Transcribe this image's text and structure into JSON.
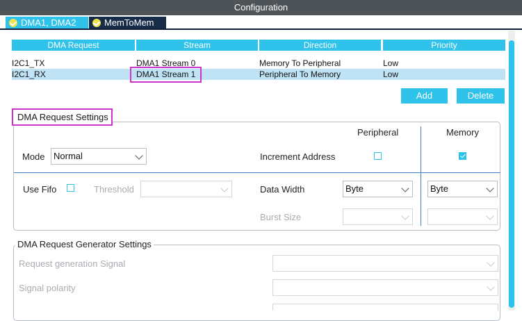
{
  "window": {
    "title": "Configuration"
  },
  "tabs": [
    {
      "label": "DMA1, DMA2",
      "icon": "check-circle-icon"
    },
    {
      "label": "MemToMem",
      "icon": "check-circle-icon"
    }
  ],
  "table": {
    "columns": [
      "DMA Request",
      "Stream",
      "Direction",
      "Priority"
    ],
    "rows": [
      {
        "request": "I2C1_TX",
        "stream": "DMA1 Stream 0",
        "direction": "Memory To Peripheral",
        "priority": "Low",
        "selected": false
      },
      {
        "request": "I2C1_RX",
        "stream": "DMA1 Stream 1",
        "direction": "Peripheral To Memory",
        "priority": "Low",
        "selected": true
      }
    ]
  },
  "buttons": {
    "add": "Add",
    "delete": "Delete"
  },
  "request_settings": {
    "title": "DMA Request Settings",
    "peripheral_header": "Peripheral",
    "memory_header": "Memory",
    "mode_label": "Mode",
    "mode_value": "Normal",
    "increment_label": "Increment Address",
    "increment_peripheral": false,
    "increment_memory": true,
    "fifo_label": "Use Fifo",
    "use_fifo": false,
    "threshold_label": "Threshold",
    "threshold_value": "",
    "data_width_label": "Data Width",
    "data_width_peripheral": "Byte",
    "data_width_memory": "Byte",
    "burst_label": "Burst Size",
    "burst_peripheral": "",
    "burst_memory": ""
  },
  "generator_settings": {
    "title": "DMA Request Generator Settings",
    "signal_label": "Request generation Signal",
    "signal_value": "",
    "polarity_label": "Signal polarity",
    "polarity_value": ""
  },
  "colors": {
    "accent": "#2fc2ea",
    "title_bar": "#4e5357",
    "active_tab": "#172c48",
    "highlight": "#cc33cc",
    "separator": "#3c7fc8"
  }
}
